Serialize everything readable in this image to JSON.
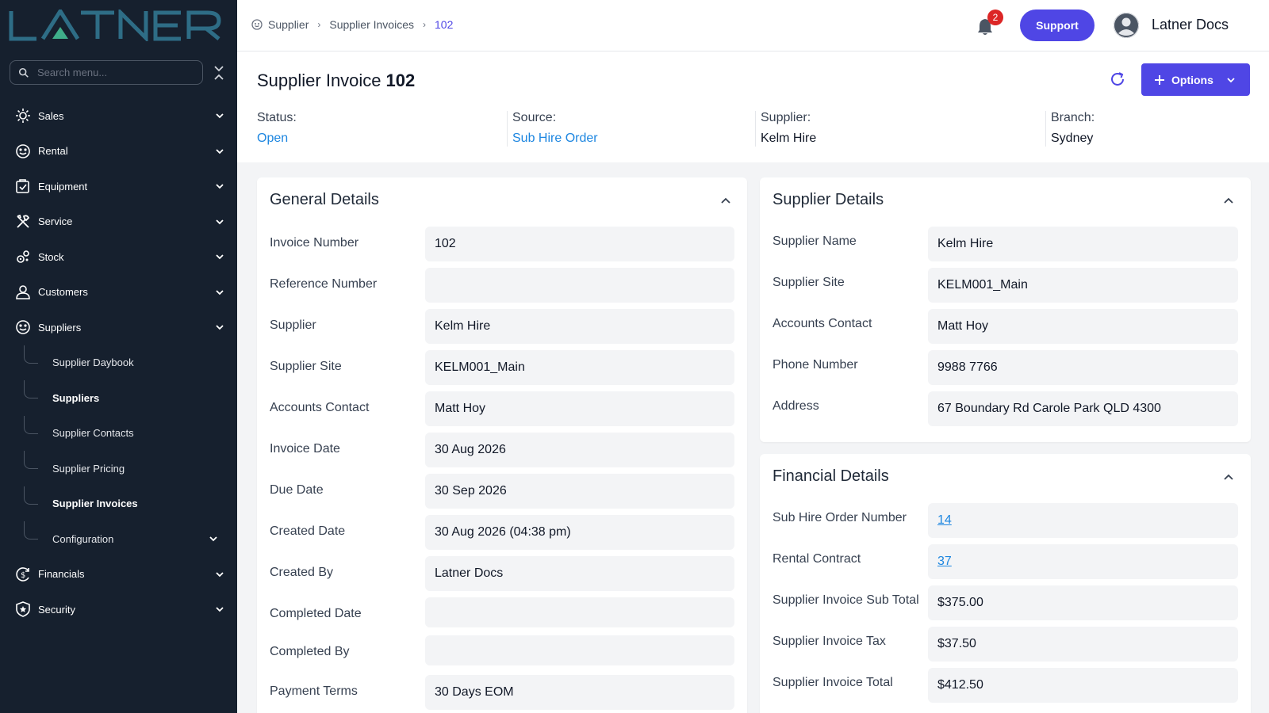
{
  "brand": {
    "logo_text": "LATNER"
  },
  "sidebar": {
    "search_placeholder": "Search menu...",
    "items": [
      {
        "label": "Sales",
        "icon": "sales-icon"
      },
      {
        "label": "Rental",
        "icon": "rental-icon"
      },
      {
        "label": "Equipment",
        "icon": "equipment-icon"
      },
      {
        "label": "Service",
        "icon": "service-icon"
      },
      {
        "label": "Stock",
        "icon": "stock-icon"
      },
      {
        "label": "Customers",
        "icon": "customers-icon"
      },
      {
        "label": "Suppliers",
        "icon": "suppliers-icon"
      },
      {
        "label": "Financials",
        "icon": "financials-icon"
      },
      {
        "label": "Security",
        "icon": "security-icon"
      }
    ],
    "suppliers_sub": [
      {
        "label": "Supplier Daybook",
        "active": false
      },
      {
        "label": "Suppliers",
        "active": true
      },
      {
        "label": "Supplier Contacts",
        "active": false
      },
      {
        "label": "Supplier Pricing",
        "active": false
      },
      {
        "label": "Supplier Invoices",
        "active": true
      },
      {
        "label": "Configuration",
        "active": false
      }
    ]
  },
  "topbar": {
    "breadcrumbs": [
      "Supplier",
      "Supplier Invoices",
      "102"
    ],
    "notification_count": "2",
    "support_label": "Support",
    "user_name": "Latner Docs"
  },
  "header": {
    "title": "Supplier Invoice",
    "title_number": "102",
    "options_label": "Options",
    "status_label": "Status:",
    "status_value": "Open",
    "source_label": "Source:",
    "source_value": "Sub Hire Order",
    "supplier_label": "Supplier:",
    "supplier_value": "Kelm Hire",
    "branch_label": "Branch:",
    "branch_value": "Sydney"
  },
  "general": {
    "title": "General Details",
    "rows": [
      {
        "label": "Invoice Number",
        "value": "102"
      },
      {
        "label": "Reference Number",
        "value": ""
      },
      {
        "label": "Supplier",
        "value": "Kelm Hire"
      },
      {
        "label": "Supplier Site",
        "value": "KELM001_Main"
      },
      {
        "label": "Accounts Contact",
        "value": "Matt Hoy"
      },
      {
        "label": "Invoice Date",
        "value": "30 Aug 2026"
      },
      {
        "label": "Due Date",
        "value": "30 Sep 2026"
      },
      {
        "label": "Created Date",
        "value": "30 Aug 2026 (04:38 pm)"
      },
      {
        "label": "Created By",
        "value": "Latner Docs"
      },
      {
        "label": "Completed Date",
        "value": ""
      },
      {
        "label": "Completed By",
        "value": ""
      },
      {
        "label": "Payment Terms",
        "value": "30 Days EOM"
      }
    ]
  },
  "supplier_details": {
    "title": "Supplier Details",
    "rows": [
      {
        "label": "Supplier Name",
        "value": "Kelm Hire"
      },
      {
        "label": "Supplier Site",
        "value": "KELM001_Main"
      },
      {
        "label": "Accounts Contact",
        "value": "Matt Hoy"
      },
      {
        "label": "Phone Number",
        "value": "9988 7766"
      },
      {
        "label": "Address",
        "value": "67 Boundary Rd Carole Park QLD 4300"
      }
    ]
  },
  "financial": {
    "title": "Financial Details",
    "rows": [
      {
        "label": "Sub Hire Order Number",
        "value": "14"
      },
      {
        "label": "Rental Contract",
        "value": "37"
      },
      {
        "label": "Supplier Invoice Sub Total",
        "value": "$375.00"
      },
      {
        "label": "Supplier Invoice Tax",
        "value": "$37.50"
      },
      {
        "label": "Supplier Invoice Total",
        "value": "$412.50"
      }
    ]
  },
  "colors": {
    "sidebar_bg": "#16202e",
    "accent": "#4f46e5",
    "link": "#1d86e0",
    "badge": "#dc2626"
  }
}
